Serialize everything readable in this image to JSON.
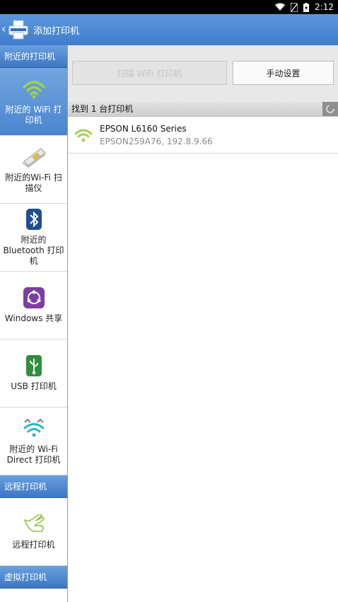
{
  "status_bar": {
    "time": "2:12"
  },
  "app_bar": {
    "title": "添加打印机"
  },
  "sidebar": {
    "sections": [
      {
        "header": "附近的打印机"
      },
      {
        "header": "远程打印机"
      },
      {
        "header": "虚拟打印机"
      }
    ],
    "items": [
      {
        "label": "附近的 WiFi 打印机",
        "icon": "wifi-icon"
      },
      {
        "label": "附近的Wi-Fi 扫描仪",
        "icon": "scanner-icon"
      },
      {
        "label": "附近的 Bluetooth 打印机",
        "icon": "bluetooth-icon"
      },
      {
        "label": "Windows 共享",
        "icon": "windows-share-icon"
      },
      {
        "label": "USB 打印机",
        "icon": "usb-icon"
      },
      {
        "label": "附近的 Wi-Fi Direct 打印机",
        "icon": "wifi-direct-icon"
      },
      {
        "label": "远程打印机",
        "icon": "remote-hand-icon"
      }
    ]
  },
  "toolbar": {
    "scan_label": "扫描 WiFi 打印机",
    "manual_label": "手动设置"
  },
  "found": {
    "text": "找到 1 台打印机"
  },
  "printers": [
    {
      "name": "EPSON L6160 Series",
      "address": "EPSON259A76, 192.8.9.66"
    }
  ],
  "colors": {
    "accent": "#4a85cf",
    "wifi_green": "#8cc63f",
    "bluetooth": "#1f4f8f",
    "windows_purple": "#7a3fa3",
    "usb_green": "#2f8f3f",
    "wifi_direct": "#2ab5c8"
  }
}
